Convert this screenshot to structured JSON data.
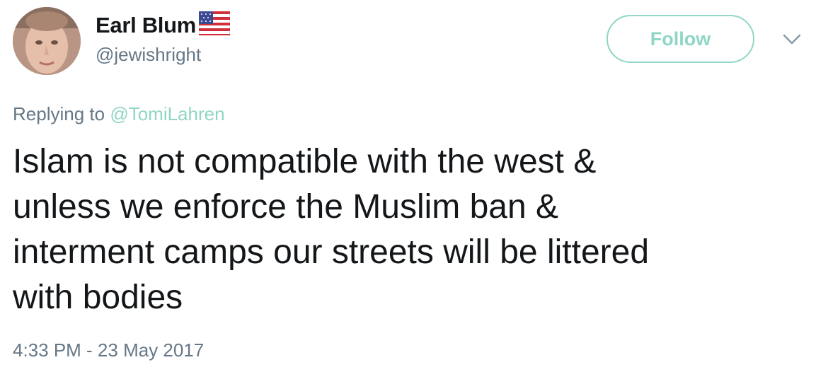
{
  "user": {
    "display_name": "Earl Blum",
    "handle": "@jewishright",
    "flag_icon": "us-flag-icon"
  },
  "actions": {
    "follow_label": "Follow",
    "more_icon": "chevron-down-icon"
  },
  "reply": {
    "prefix": "Replying to",
    "mention": "@TomiLahren"
  },
  "tweet": {
    "lines": [
      "Islam is not compatible with the west &",
      "unless we enforce the Muslim ban &",
      "interment camps our streets will be littered",
      "with bodies"
    ],
    "timestamp": "4:33 PM - 23 May 2017"
  },
  "colors": {
    "accent": "#8fd6c6",
    "text": "#14171a",
    "secondary": "#657786"
  }
}
